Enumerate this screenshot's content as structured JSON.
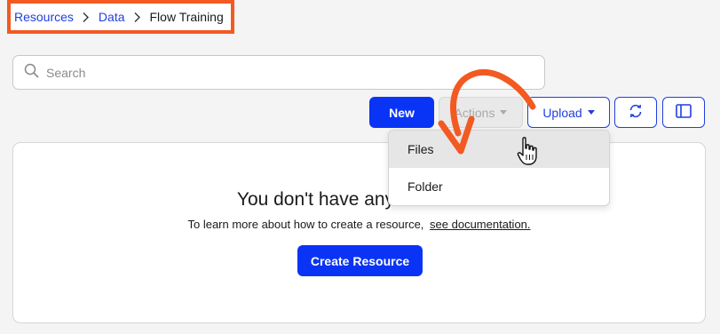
{
  "breadcrumb": {
    "items": [
      "Resources",
      "Data",
      "Flow Training"
    ]
  },
  "search": {
    "placeholder": "Search",
    "value": ""
  },
  "toolbar": {
    "new_label": "New",
    "actions_label": "Actions",
    "upload_label": "Upload"
  },
  "upload_menu": {
    "items": [
      "Files",
      "Folder"
    ],
    "highlighted": "Files"
  },
  "empty_state": {
    "title": "You don't have any resources",
    "text": "To learn more about how to create a resource,",
    "link": "see documentation.",
    "button": "Create Resource"
  },
  "colors": {
    "primary": "#0a34f5",
    "link": "#1f3fe0",
    "highlight_box": "#f25a22",
    "annotation_arrow": "#f25a22"
  },
  "icons": [
    "chevron-right-icon",
    "search-icon",
    "caret-down-icon",
    "refresh-icon",
    "panel-icon",
    "pointer-hand-icon",
    "curved-arrow-icon"
  ]
}
